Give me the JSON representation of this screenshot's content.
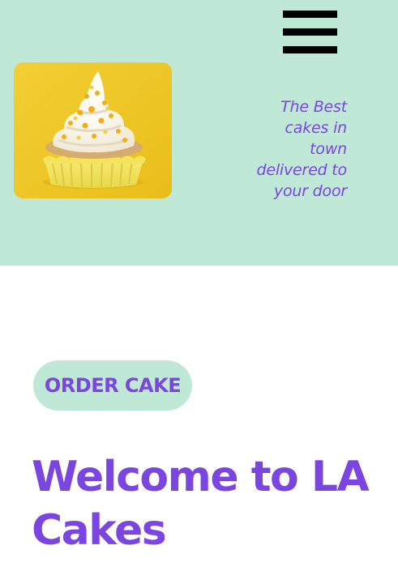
{
  "header": {
    "menu_icon": "hamburger-menu-icon",
    "hero_image": "cupcake-image",
    "tagline": "The Best cakes in town delivered to your door",
    "background_color": "#bfe8d6"
  },
  "main": {
    "order_button_label": "ORDER CAKE",
    "title": "Welcome to LA Cakes"
  },
  "colors": {
    "accent": "#7b45e0",
    "mint": "#bfe8d6"
  }
}
